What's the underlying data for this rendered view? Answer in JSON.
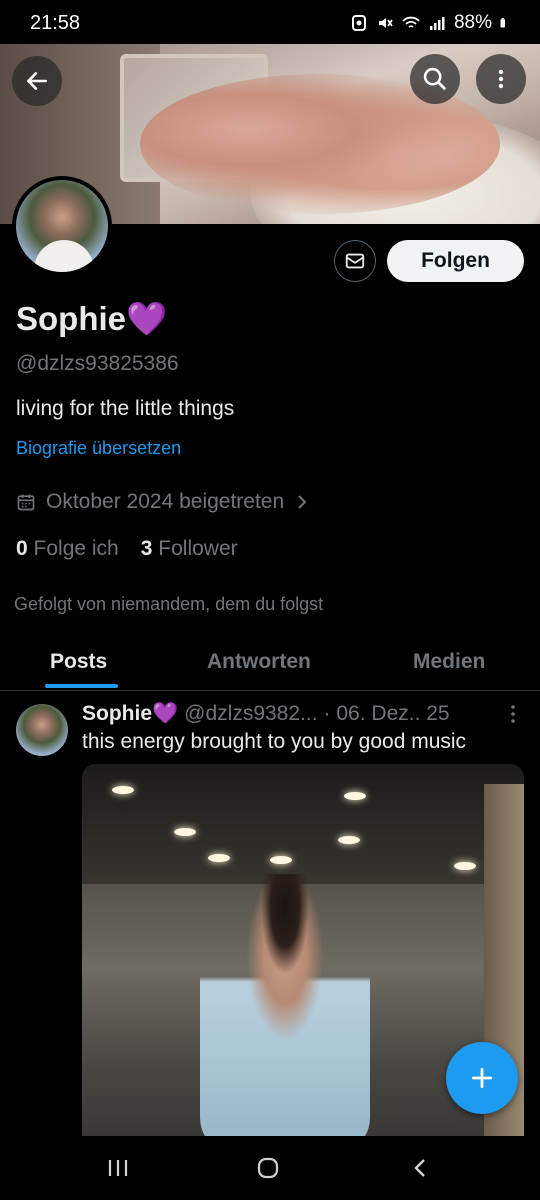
{
  "status_bar": {
    "time": "21:58",
    "battery": "88%"
  },
  "profile": {
    "name": "Sophie💜",
    "handle": "@dzlzs93825386",
    "bio": "living for the little things",
    "translate_link": "Biografie übersetzen",
    "joined": "Oktober 2024 beigetreten",
    "following_count": "0",
    "following_label": "Folge ich",
    "followers_count": "3",
    "followers_label": "Follower",
    "followed_by": "Gefolgt von niemandem, dem du folgst",
    "follow_button": "Folgen"
  },
  "tabs": [
    {
      "label": "Posts",
      "active": true
    },
    {
      "label": "Antworten",
      "active": false
    },
    {
      "label": "Medien",
      "active": false
    }
  ],
  "post": {
    "author_name": "Sophie💜",
    "author_handle": "@dzlzs9382...",
    "date": "· 06. Dez.. 25",
    "text": "this energy brought to you by good music"
  },
  "icons": {
    "back": "arrow-left-icon",
    "search": "search-icon",
    "more": "more-vertical-icon",
    "message": "envelope-icon",
    "calendar": "calendar-icon",
    "compose": "plus-icon"
  },
  "colors": {
    "accent": "#1d9bf0",
    "background": "#000000",
    "secondary_text": "#71767b",
    "follow_button_bg": "#eff3f4"
  }
}
